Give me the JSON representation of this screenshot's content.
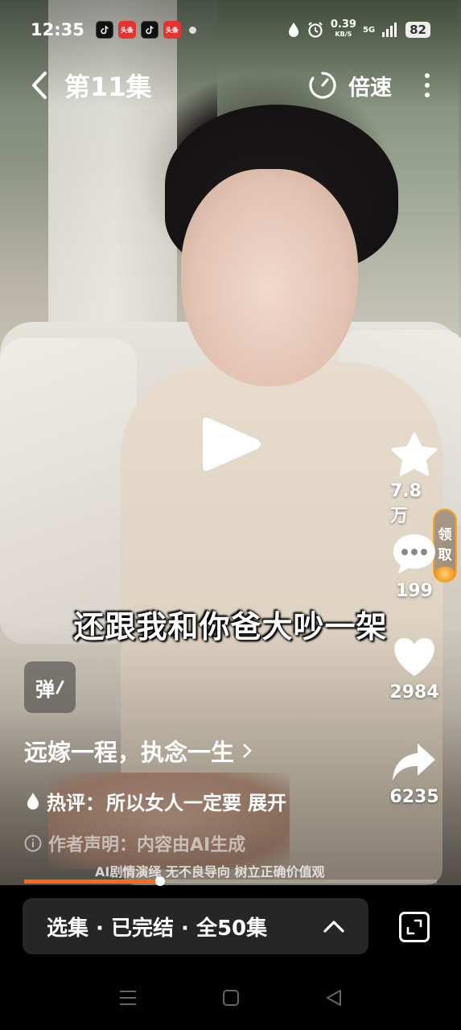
{
  "status_bar": {
    "time": "12:35",
    "app_icons": [
      "tiktok-icon",
      "toutiao-icon",
      "tiktok-icon",
      "toutiao-icon"
    ],
    "toutiao_label": "头条",
    "net_speed": "0.39",
    "net_unit": "KB/S",
    "network": "5G",
    "battery": "82"
  },
  "header": {
    "episode_title": "第11集",
    "speed_label": "倍速"
  },
  "rail": {
    "collect_count": "7.8万",
    "comment_count": "199",
    "like_count": "2984",
    "share_count": "6235",
    "reward_label": [
      "领",
      "取"
    ]
  },
  "subtitle": "还跟我和你爸大吵一架",
  "danmaku_label": "弹",
  "info": {
    "series_title": "远嫁一程，执念一生",
    "hot_comment_prefix": "热评：",
    "hot_comment_text": "所以女人一定要",
    "expand_label": "展开",
    "author_note": "作者声明：内容由AI生成",
    "ai_note": "AI剧情演绎 无不良导向 树立正确价值观"
  },
  "progress": {
    "played_fraction": 0.33
  },
  "episode_bar": {
    "label": "选集 · 已完结 · 全50集"
  },
  "colors": {
    "progress": "#ff6a13",
    "reward_border": "#f5a623",
    "bar_bg": "#262626"
  }
}
